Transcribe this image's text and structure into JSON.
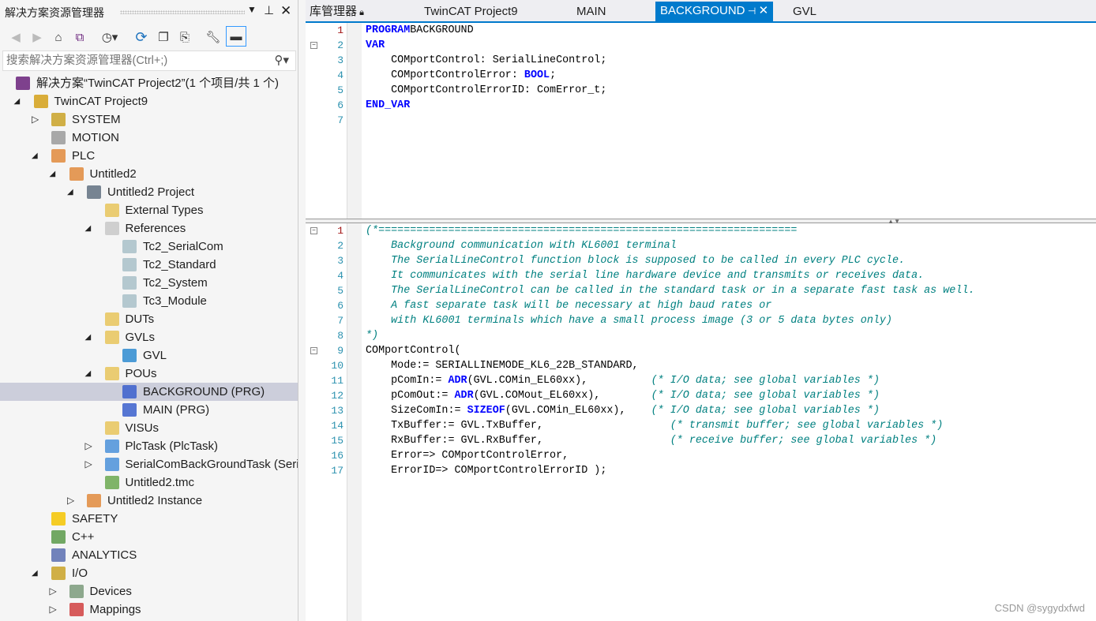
{
  "explorer": {
    "title": "解决方案资源管理器",
    "search_placeholder": "搜索解决方案资源管理器(Ctrl+;)",
    "toolbar_icons": [
      "back-icon",
      "forward-icon",
      "home-icon",
      "vs-switch-views-icon",
      "history-icon",
      "sync-icon",
      "collapse-all-icon",
      "show-all-files-icon",
      "properties-wrench-icon",
      "preview-icon"
    ],
    "tree": [
      {
        "label": "解决方案“TwinCAT Project2”(1 个项目/共 1 个)",
        "depth": 0,
        "exp": "",
        "icon": "solution-icon",
        "color": "#68217a"
      },
      {
        "label": "TwinCAT Project9",
        "depth": 1,
        "exp": "open",
        "icon": "twincat-project-icon",
        "color": "#d4a017"
      },
      {
        "label": "SYSTEM",
        "depth": 2,
        "exp": "closed",
        "icon": "system-icon",
        "color": "#c9a227"
      },
      {
        "label": "MOTION",
        "depth": 2,
        "exp": "",
        "icon": "motion-icon",
        "color": "#9a9a9a"
      },
      {
        "label": "PLC",
        "depth": 2,
        "exp": "open",
        "icon": "plc-icon",
        "color": "#e08a3c"
      },
      {
        "label": "Untitled2",
        "depth": 3,
        "exp": "open",
        "icon": "plc-project-icon",
        "color": "#e08a3c"
      },
      {
        "label": "Untitled2 Project",
        "depth": 4,
        "exp": "open",
        "icon": "plc-project-file-icon",
        "color": "#607080"
      },
      {
        "label": "External Types",
        "depth": 5,
        "exp": "",
        "icon": "folder-icon",
        "color": "#e8c45a"
      },
      {
        "label": "References",
        "depth": 5,
        "exp": "open",
        "icon": "folder-open-gray-icon",
        "color": "#c8c8c8"
      },
      {
        "label": "Tc2_SerialCom",
        "depth": 6,
        "exp": "",
        "icon": "library-reference-icon",
        "color": "#a8c0c8"
      },
      {
        "label": "Tc2_Standard",
        "depth": 6,
        "exp": "",
        "icon": "library-reference-icon",
        "color": "#a8c0c8"
      },
      {
        "label": "Tc2_System",
        "depth": 6,
        "exp": "",
        "icon": "library-reference-icon",
        "color": "#a8c0c8"
      },
      {
        "label": "Tc3_Module",
        "depth": 6,
        "exp": "",
        "icon": "library-reference-icon",
        "color": "#a8c0c8"
      },
      {
        "label": "DUTs",
        "depth": 5,
        "exp": "",
        "icon": "folder-icon",
        "color": "#e8c45a"
      },
      {
        "label": "GVLs",
        "depth": 5,
        "exp": "open",
        "icon": "folder-open-icon",
        "color": "#e8c45a"
      },
      {
        "label": "GVL",
        "depth": 6,
        "exp": "",
        "icon": "gvl-globe-icon",
        "color": "#2e8bd0"
      },
      {
        "label": "POUs",
        "depth": 5,
        "exp": "open",
        "icon": "folder-open-icon",
        "color": "#e8c45a"
      },
      {
        "label": "BACKGROUND (PRG)",
        "depth": 6,
        "exp": "",
        "icon": "program-icon",
        "color": "#3a5fcd",
        "selected": true
      },
      {
        "label": "MAIN (PRG)",
        "depth": 6,
        "exp": "",
        "icon": "program-icon",
        "color": "#3a5fcd"
      },
      {
        "label": "VISUs",
        "depth": 5,
        "exp": "",
        "icon": "folder-icon",
        "color": "#e8c45a"
      },
      {
        "label": "PlcTask (PlcTask)",
        "depth": 5,
        "exp": "closed",
        "icon": "task-icon",
        "color": "#4a90d9"
      },
      {
        "label": "SerialComBackGroundTask (SerialComBackGroundTask)",
        "depth": 5,
        "exp": "closed",
        "icon": "task-icon",
        "color": "#4a90d9"
      },
      {
        "label": "Untitled2.tmc",
        "depth": 5,
        "exp": "",
        "icon": "tmc-icon",
        "color": "#6aa84f"
      },
      {
        "label": "Untitled2 Instance",
        "depth": 4,
        "exp": "closed",
        "icon": "plc-instance-icon",
        "color": "#e08a3c"
      },
      {
        "label": "SAFETY",
        "depth": 2,
        "exp": "",
        "icon": "safety-icon",
        "color": "#f5c400"
      },
      {
        "label": "C++",
        "depth": 2,
        "exp": "",
        "icon": "cpp-icon",
        "color": "#5a9a4a"
      },
      {
        "label": "ANALYTICS",
        "depth": 2,
        "exp": "",
        "icon": "analytics-icon",
        "color": "#5a6fb0"
      },
      {
        "label": "I/O",
        "depth": 2,
        "exp": "open",
        "icon": "io-icon",
        "color": "#c9a227"
      },
      {
        "label": "Devices",
        "depth": 3,
        "exp": "closed",
        "icon": "devices-icon",
        "color": "#7a9a7a"
      },
      {
        "label": "Mappings",
        "depth": 3,
        "exp": "closed",
        "icon": "mappings-icon",
        "color": "#d04040"
      }
    ]
  },
  "editor": {
    "tabs": [
      {
        "label": "库管理器",
        "pinned_lock": true
      },
      {
        "label": "TwinCAT Project9"
      },
      {
        "label": "MAIN"
      },
      {
        "label": "BACKGROUND",
        "active": true
      },
      {
        "label": "GVL"
      }
    ],
    "declaration": [
      [
        [
          "kw",
          "PROGRAM"
        ],
        [
          "",
          "BACKGROUND"
        ]
      ],
      [
        [
          "kw",
          "VAR"
        ]
      ],
      [
        [
          "",
          "    COMportControl: SerialLineControl;"
        ]
      ],
      [
        [
          "",
          "    COMportControlError: "
        ],
        [
          "kw",
          "BOOL"
        ],
        [
          "",
          ";"
        ]
      ],
      [
        [
          "",
          "    COMportControlErrorID: ComError_t;"
        ]
      ],
      [
        [
          "kw",
          "END_VAR"
        ]
      ],
      []
    ],
    "declaration_folds": [
      2
    ],
    "implementation": [
      [
        [
          "cm",
          "(*=================================================================="
        ]
      ],
      [
        [
          "cm",
          "    Background communication with KL6001 terminal"
        ]
      ],
      [
        [
          "cm",
          "    The SerialLineControl function block is supposed to be called in every PLC cycle."
        ]
      ],
      [
        [
          "cm",
          "    It communicates with the serial line hardware device and transmits or receives data."
        ]
      ],
      [
        [
          "cm",
          "    The SerialLineControl can be called in the standard task or in a separate fast task as well."
        ]
      ],
      [
        [
          "cm",
          "    A fast separate task will be necessary at high baud rates or"
        ]
      ],
      [
        [
          "cm",
          "    with KL6001 terminals which have a small process image (3 or 5 data bytes only)"
        ]
      ],
      [
        [
          "cm",
          "*)"
        ]
      ],
      [
        [
          "",
          "COMportControl("
        ]
      ],
      [
        [
          "",
          "    Mode:= SERIALLINEMODE_KL6_22B_STANDARD,"
        ]
      ],
      [
        [
          "",
          "    pComIn:= "
        ],
        [
          "kw",
          "ADR"
        ],
        [
          "",
          "(GVL.COMin_EL60xx),          "
        ],
        [
          "cm",
          "(* I/O data; see global variables *)"
        ]
      ],
      [
        [
          "",
          "    pComOut:= "
        ],
        [
          "kw",
          "ADR"
        ],
        [
          "",
          "(GVL.COMout_EL60xx),        "
        ],
        [
          "cm",
          "(* I/O data; see global variables *)"
        ]
      ],
      [
        [
          "",
          "    SizeComIn:= "
        ],
        [
          "kw",
          "SIZEOF"
        ],
        [
          "",
          "(GVL.COMin_EL60xx),    "
        ],
        [
          "cm",
          "(* I/O data; see global variables *)"
        ]
      ],
      [
        [
          "",
          "    TxBuffer:= GVL.TxBuffer,                    "
        ],
        [
          "cm",
          "(* transmit buffer; see global variables *)"
        ]
      ],
      [
        [
          "",
          "    RxBuffer:= GVL.RxBuffer,                    "
        ],
        [
          "cm",
          "(* receive buffer; see global variables *)"
        ]
      ],
      [
        [
          "",
          "    Error=> COMportControlError,"
        ]
      ],
      [
        [
          "",
          "    ErrorID=> COMportControlErrorID );"
        ]
      ]
    ],
    "implementation_folds": [
      1,
      9
    ]
  },
  "watermark": "CSDN @sygydxfwd"
}
